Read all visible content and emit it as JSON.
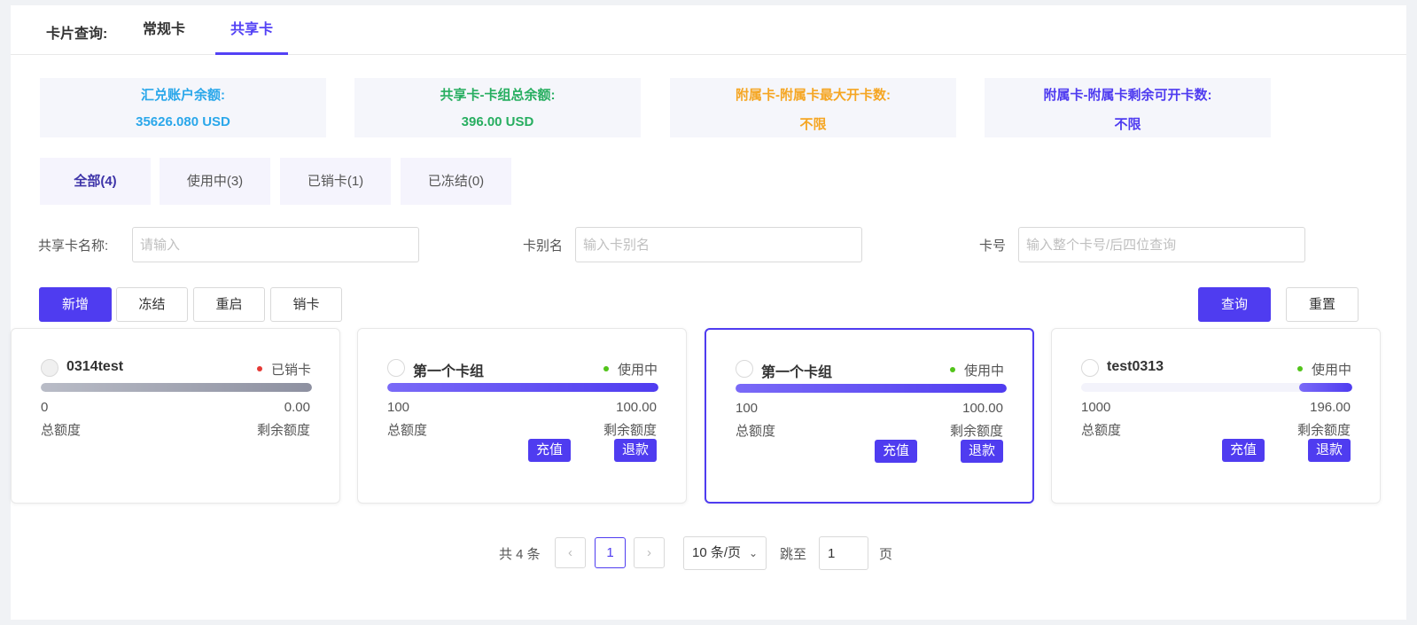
{
  "tabs": {
    "prefix": "卡片查询:",
    "items": [
      {
        "label": "常规卡",
        "active": false
      },
      {
        "label": "共享卡",
        "active": true
      }
    ]
  },
  "stats": [
    {
      "label": "汇兑账户余额:",
      "value": "35626.080 USD",
      "color": "#2aa7ea"
    },
    {
      "label": "共享卡-卡组总余额:",
      "value": "396.00 USD",
      "color": "#27ae60"
    },
    {
      "label": "附属卡-附属卡最大开卡数:",
      "value": "不限",
      "color": "#f5a623"
    },
    {
      "label": "附属卡-附属卡剩余可开卡数:",
      "value": "不限",
      "color": "#4f3cf0"
    }
  ],
  "filters": [
    {
      "label": "全部(4)",
      "active": true
    },
    {
      "label": "使用中(3)",
      "active": false
    },
    {
      "label": "已销卡(1)",
      "active": false
    },
    {
      "label": "已冻结(0)",
      "active": false
    }
  ],
  "form": {
    "shared_name_label": "共享卡名称:",
    "shared_name_placeholder": "请输入",
    "alias_label": "卡别名",
    "alias_placeholder": "输入卡别名",
    "cardno_label": "卡号",
    "cardno_placeholder": "输入整个卡号/后四位查询"
  },
  "actions": {
    "add": "新增",
    "freeze": "冻结",
    "restart": "重启",
    "cancel_card": "销卡",
    "query": "查询",
    "reset": "重置"
  },
  "card_labels": {
    "total": "总额度",
    "remain": "剩余额度",
    "recharge": "充值",
    "refund": "退款"
  },
  "cards": [
    {
      "name": "0314test",
      "status": "已销卡",
      "status_color": "#e53935",
      "total": "0",
      "remaining": "0.00",
      "remaining_ratio": 1.0,
      "bar_color": "gray",
      "selected": false
    },
    {
      "name": "第一个卡组",
      "status": "使用中",
      "status_color": "#52c41a",
      "total": "100",
      "remaining": "100.00",
      "remaining_ratio": 1.0,
      "bar_color": "purple",
      "selected": false
    },
    {
      "name": "第一个卡组",
      "status": "使用中",
      "status_color": "#52c41a",
      "total": "100",
      "remaining": "100.00",
      "remaining_ratio": 1.0,
      "bar_color": "purple",
      "selected": true
    },
    {
      "name": "test0313",
      "status": "使用中",
      "status_color": "#52c41a",
      "total": "1000",
      "remaining": "196.00",
      "remaining_ratio": 0.196,
      "bar_color": "purple",
      "selected": false
    }
  ],
  "pagination": {
    "total_text": "共 4 条",
    "prev": "‹",
    "current_page": "1",
    "next": "›",
    "page_size": "10 条/页",
    "jump_label": "跳至",
    "jump_value": "1",
    "page_suffix": "页"
  }
}
